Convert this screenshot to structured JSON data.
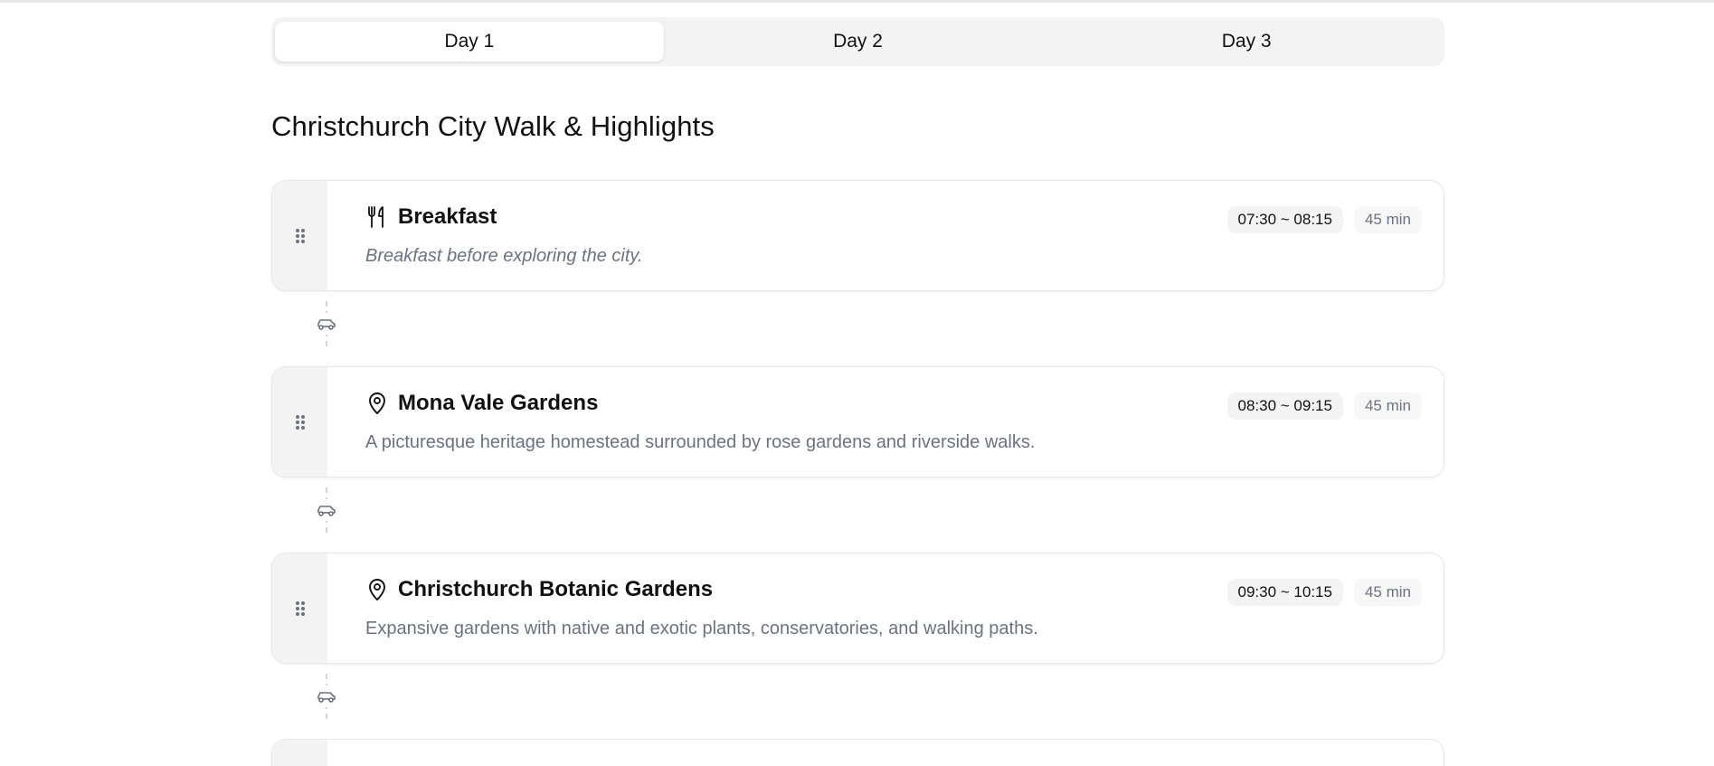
{
  "tabs": [
    {
      "label": "Day 1",
      "active": true
    },
    {
      "label": "Day 2",
      "active": false
    },
    {
      "label": "Day 3",
      "active": false
    }
  ],
  "title": "Christchurch City Walk & Highlights",
  "items": [
    {
      "icon": "utensils-icon",
      "title": "Breakfast",
      "description": "Breakfast before exploring the city.",
      "time": "07:30 ~ 08:15",
      "duration": "45 min"
    },
    {
      "icon": "map-pin-icon",
      "title": "Mona Vale Gardens",
      "description": "A picturesque heritage homestead surrounded by rose gardens and riverside walks.",
      "time": "08:30 ~ 09:15",
      "duration": "45 min"
    },
    {
      "icon": "map-pin-icon",
      "title": "Christchurch Botanic Gardens",
      "description": "Expansive gardens with native and exotic plants, conservatories, and walking paths.",
      "time": "09:30 ~ 10:15",
      "duration": "45 min"
    }
  ],
  "transport_icon": "car-icon",
  "colors": {
    "tab_bg": "#f3f3f3",
    "card_border": "#e5e7eb",
    "muted_text": "#6b7280"
  }
}
